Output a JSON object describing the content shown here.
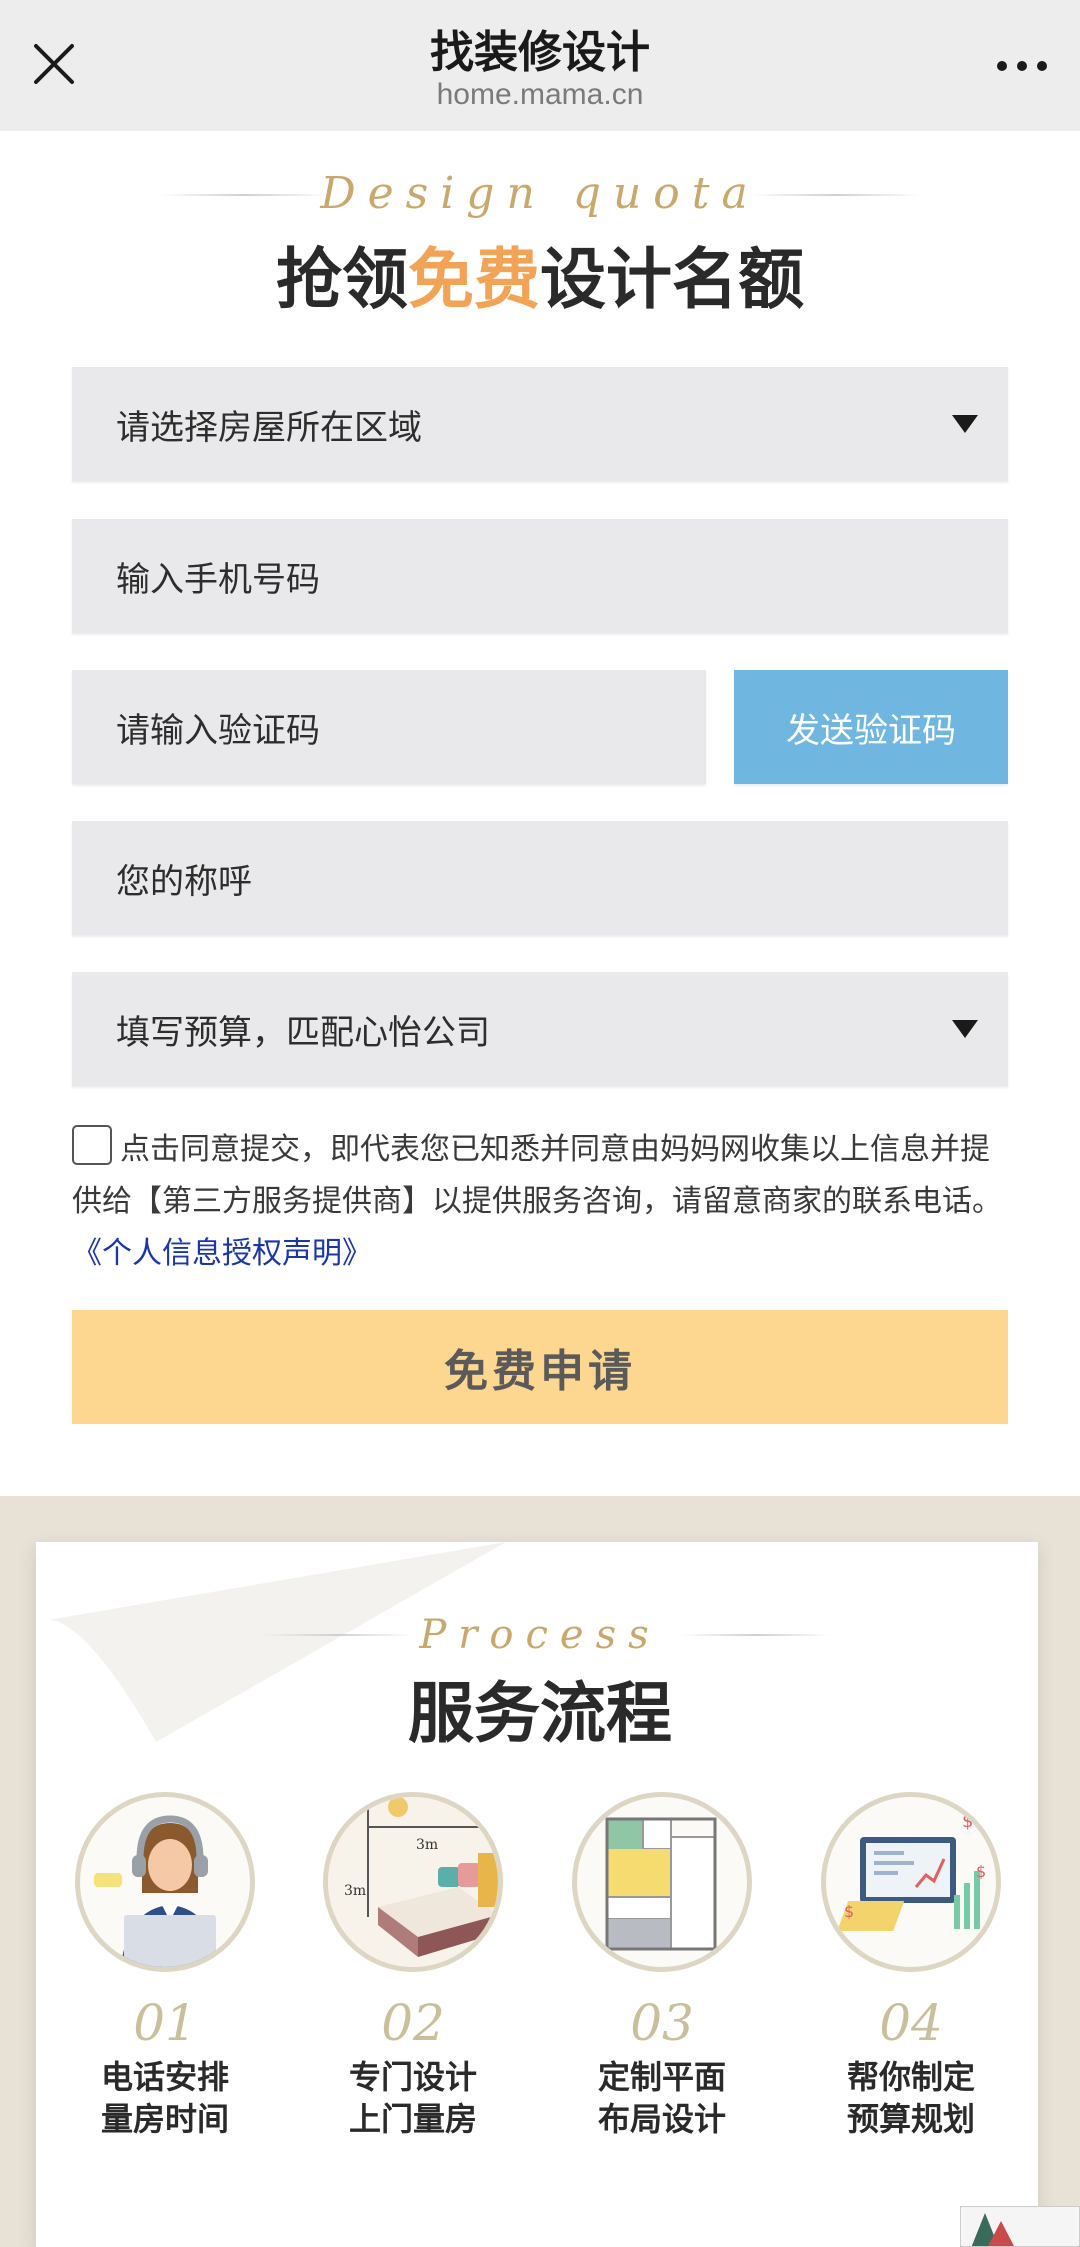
{
  "topbar": {
    "title": "找装修设计",
    "url": "home.mama.cn"
  },
  "header": {
    "script": "Design quota",
    "heading_before": "抢领",
    "heading_accent": "免费",
    "heading_after": "设计名额"
  },
  "form": {
    "region_select": "请选择房屋所在区域",
    "phone_input": "输入手机号码",
    "code_input": "请输入验证码",
    "send_code_button": "发送验证码",
    "name_input": "您的称呼",
    "budget_select": "填写预算，匹配心怡公司",
    "consent_text": "点击同意提交，即代表您已知悉并同意由妈妈网收集以上信息并提供给【第三方服务提供商】以提供服务咨询，请留意商家的联系电话。",
    "consent_link": "《个人信息授权声明》",
    "submit_button": "免费申请"
  },
  "process": {
    "script": "Process",
    "heading": "服务流程",
    "steps": [
      {
        "num": "01",
        "line1": "电话安排",
        "line2": "量房时间",
        "icon": "customer-service-icon"
      },
      {
        "num": "02",
        "line1": "专门设计",
        "line2": "上门量房",
        "icon": "room-measure-icon",
        "label_a": "3m",
        "label_b": "3m"
      },
      {
        "num": "03",
        "line1": "定制平面",
        "line2": "布局设计",
        "icon": "floor-plan-icon"
      },
      {
        "num": "04",
        "line1": "帮你制定",
        "line2": "预算规划",
        "icon": "budget-chart-icon",
        "symbol": "$"
      }
    ]
  },
  "colors": {
    "accent_orange": "#f2a356",
    "send_button_blue": "#6fb6e0",
    "submit_button_yellow": "#fdd690",
    "link_blue": "#1a37a8",
    "gold": "#c8a86c"
  }
}
